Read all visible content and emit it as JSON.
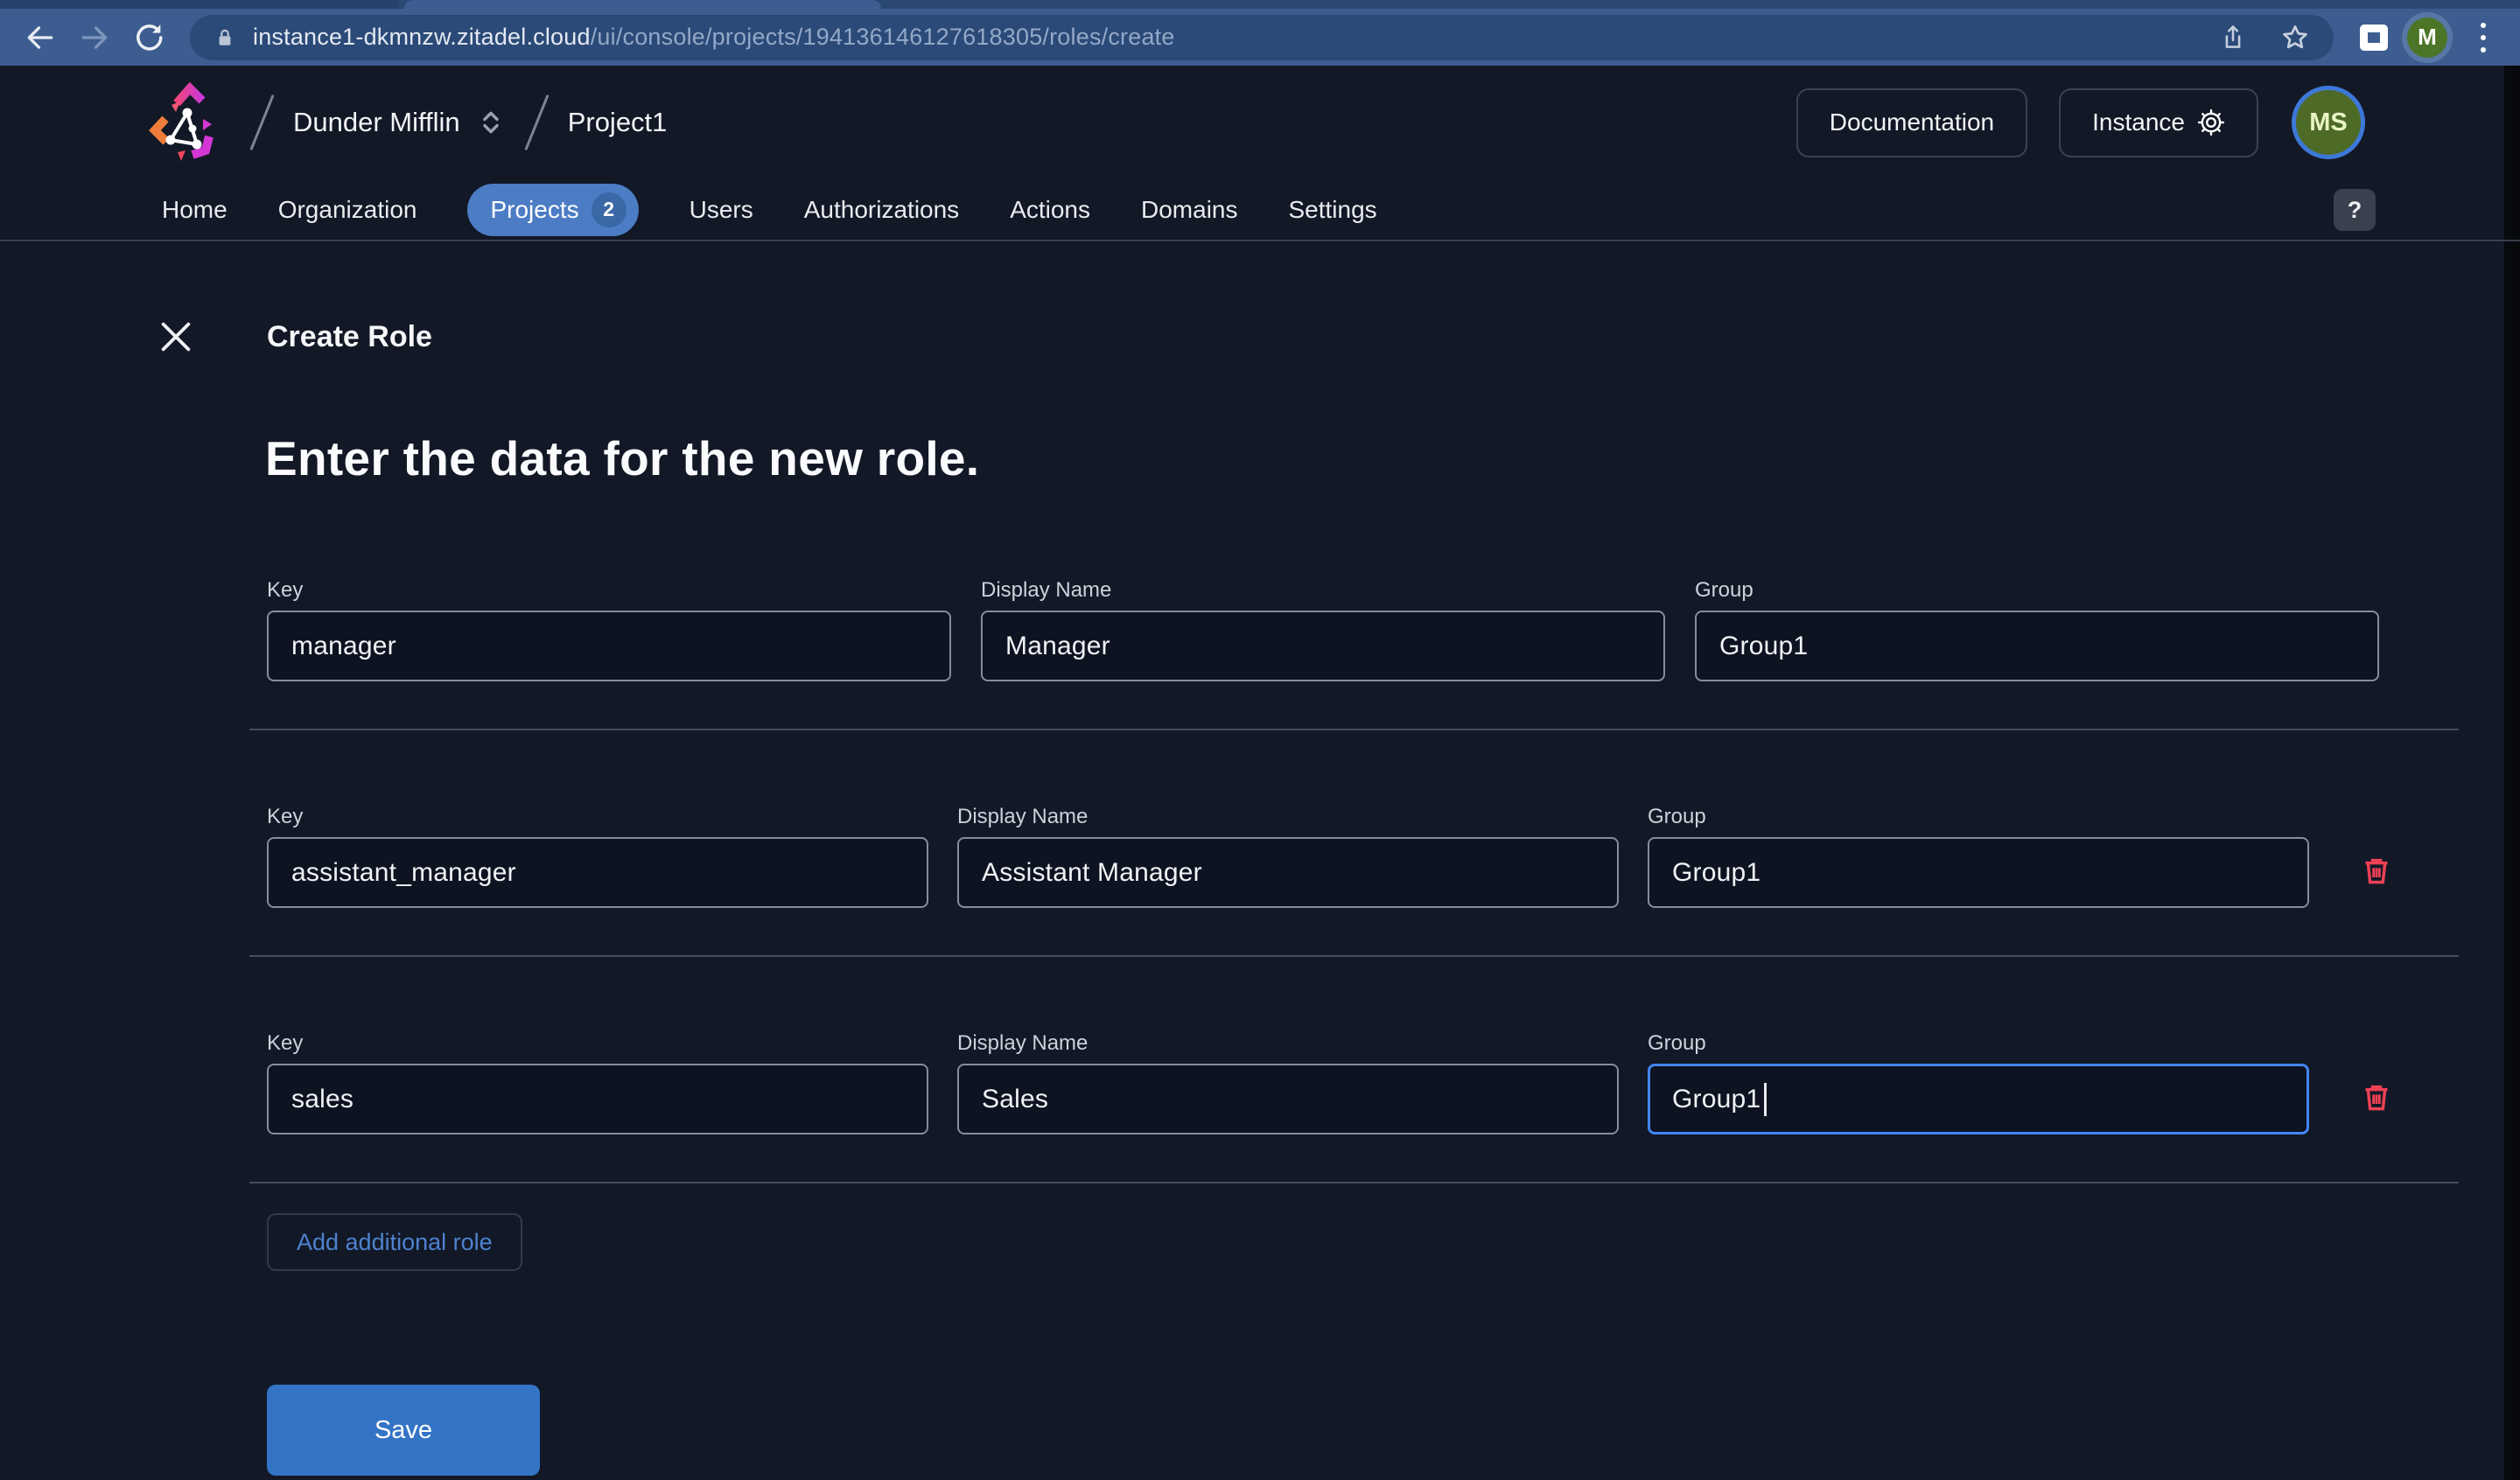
{
  "browser": {
    "url": {
      "domain": "instance1-dkmnzw.zitadel.cloud",
      "path": "/ui/console/projects/194136146127618305/roles/create"
    },
    "profile_initial": "M"
  },
  "header": {
    "breadcrumb": {
      "org": "Dunder Mifflin",
      "project": "Project1"
    },
    "documentation_button": "Documentation",
    "instance_button": "Instance",
    "user_initials": "MS"
  },
  "nav": {
    "items": [
      {
        "label": "Home"
      },
      {
        "label": "Organization"
      },
      {
        "label": "Projects",
        "active": true,
        "badge": "2"
      },
      {
        "label": "Users"
      },
      {
        "label": "Authorizations"
      },
      {
        "label": "Actions"
      },
      {
        "label": "Domains"
      },
      {
        "label": "Settings"
      }
    ],
    "help_button": "?"
  },
  "page": {
    "title": "Create Role",
    "heading": "Enter the data for the new role.",
    "add_role_button": "Add additional role",
    "save_button": "Save"
  },
  "form": {
    "labels": {
      "key": "Key",
      "display_name": "Display Name",
      "group": "Group"
    },
    "roles": [
      {
        "key": "manager",
        "display_name": "Manager",
        "group": "Group1",
        "deletable": false,
        "focused_field": null
      },
      {
        "key": "assistant_manager",
        "display_name": "Assistant Manager",
        "group": "Group1",
        "deletable": true,
        "focused_field": null
      },
      {
        "key": "sales",
        "display_name": "Sales",
        "group": "Group1",
        "deletable": true,
        "focused_field": "group"
      }
    ]
  },
  "colors": {
    "page_bg": "#121826",
    "browser_bar": "#3d5d90",
    "url_pill": "#2b4a78",
    "active_tab_blue": "#4b7cc4",
    "save_blue": "#3474c6",
    "link_blue": "#4e82d0",
    "focus_blue": "#4285f4",
    "danger_red": "#ee4155",
    "avatar_olive": "#4d6b27",
    "avatar_ring_blue": "#3d78d8"
  }
}
